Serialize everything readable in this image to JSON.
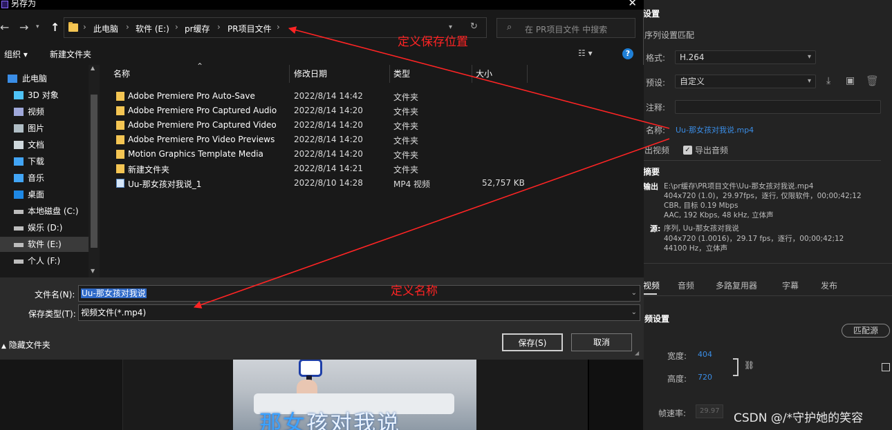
{
  "dialog": {
    "title": "另存为",
    "close_glyph": "✕",
    "nav": {
      "back": "←",
      "forward": "→",
      "up": "↑"
    },
    "breadcrumb": [
      "此电脑",
      "软件 (E:)",
      "pr缓存",
      "PR项目文件"
    ],
    "search_placeholder": "在 PR项目文件 中搜索",
    "toolbar": {
      "organize": "组织 ▾",
      "new_folder": "新建文件夹",
      "help": "?"
    },
    "sidebar": [
      {
        "label": "此电脑",
        "icon": "computer-icon"
      },
      {
        "label": "3D 对象",
        "icon": "cube-icon"
      },
      {
        "label": "视频",
        "icon": "video-icon"
      },
      {
        "label": "图片",
        "icon": "picture-icon"
      },
      {
        "label": "文档",
        "icon": "document-icon"
      },
      {
        "label": "下载",
        "icon": "download-icon"
      },
      {
        "label": "音乐",
        "icon": "music-icon"
      },
      {
        "label": "桌面",
        "icon": "desktop-icon"
      },
      {
        "label": "本地磁盘 (C:)",
        "icon": "drive-icon"
      },
      {
        "label": "娱乐 (D:)",
        "icon": "drive-icon"
      },
      {
        "label": "软件 (E:)",
        "icon": "drive-icon"
      },
      {
        "label": "个人 (F:)",
        "icon": "drive-icon"
      }
    ],
    "columns": [
      "名称",
      "修改日期",
      "类型",
      "大小"
    ],
    "files": [
      {
        "name": "Adobe Premiere Pro Auto-Save",
        "date": "2022/8/14 14:42",
        "type": "文件夹",
        "size": ""
      },
      {
        "name": "Adobe Premiere Pro Captured Audio",
        "date": "2022/8/14 14:20",
        "type": "文件夹",
        "size": ""
      },
      {
        "name": "Adobe Premiere Pro Captured Video",
        "date": "2022/8/14 14:20",
        "type": "文件夹",
        "size": ""
      },
      {
        "name": "Adobe Premiere Pro Video Previews",
        "date": "2022/8/14 14:20",
        "type": "文件夹",
        "size": ""
      },
      {
        "name": "Motion Graphics Template Media",
        "date": "2022/8/14 14:20",
        "type": "文件夹",
        "size": ""
      },
      {
        "name": "新建文件夹",
        "date": "2022/8/14 14:21",
        "type": "文件夹",
        "size": ""
      },
      {
        "name": "Uu-那女孩对我说_1",
        "date": "2022/8/10 14:28",
        "type": "MP4 视频",
        "size": "52,757 KB"
      }
    ],
    "filename_label": "文件名(N):",
    "filename_value": "Uu-那女孩对我说",
    "filetype_label": "保存类型(T):",
    "filetype_value": "视频文件(*.mp4)",
    "hide_folders": "隐藏文件夹",
    "save": "保存(S)",
    "cancel": "取消"
  },
  "annotations": {
    "location": "定义保存位置",
    "name": "定义名称",
    "color": "#ff2424"
  },
  "export": {
    "title": "设置",
    "match_sequence": "序列设置匹配",
    "format_label": "格式:",
    "format_value": "H.264",
    "preset_label": "预设:",
    "preset_value": "自定义",
    "comment_label": "注释:",
    "output_name_label": "名称:",
    "output_name_value": "Uu-那女孩对我说.mp4",
    "export_video": "出视频",
    "export_audio": "导出音频",
    "summary_title": "摘要",
    "output_label": "输出",
    "output_lines": [
      "E:\\pr缓存\\PR项目文件\\Uu-那女孩对我说.mp4",
      "404x720 (1.0)，29.97fps，逐行, 仅限软件，00;00;42;12",
      "CBR, 目标 0.19 Mbps",
      "AAC, 192 Kbps, 48  kHz, 立体声"
    ],
    "source_label": "源:",
    "source_lines": [
      "序列, Uu-那女孩对我说",
      "404x720 (1.0016)，29.17 fps，逐行，00;00;42;12",
      "44100 Hz，立体声"
    ],
    "tabs": [
      "视频",
      "音频",
      "多路复用器",
      "字幕",
      "发布"
    ],
    "basic_video": "频设置",
    "match_source": "匹配源",
    "width_label": "宽度:",
    "width_value": "404",
    "height_label": "高度:",
    "height_value": "720",
    "framerate_label": "帧速率:",
    "framerate_value": "29.97"
  },
  "preview": {
    "caption_blue": "那女",
    "caption_rest": "孩对我说"
  },
  "watermark": "CSDN @/*守护她的笑容"
}
